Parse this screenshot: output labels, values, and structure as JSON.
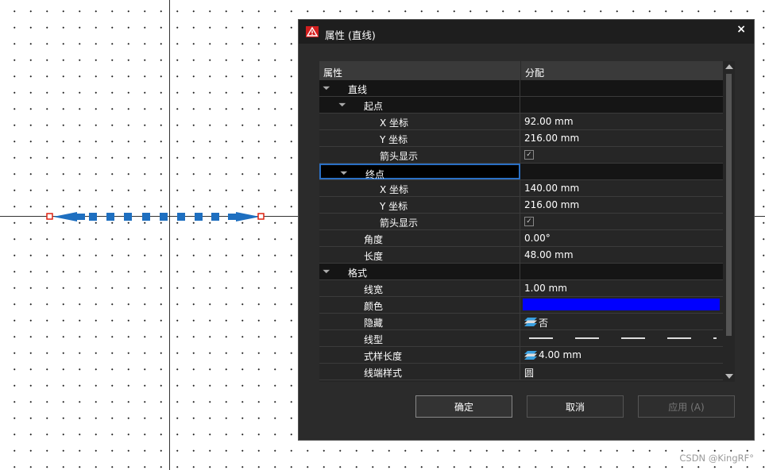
{
  "dialog": {
    "title": "属性 (直线)",
    "close_label": "×",
    "header": {
      "col_name": "属性",
      "col_value": "分配"
    },
    "rows": [
      {
        "label": "直线",
        "value": "",
        "level": 0,
        "kind": "group",
        "expandable": true
      },
      {
        "label": "起点",
        "value": "",
        "level": 1,
        "kind": "group",
        "expandable": true
      },
      {
        "label": "X 坐标",
        "value": "92.00 mm",
        "level": 2,
        "kind": "text"
      },
      {
        "label": "Y 坐标",
        "value": "216.00 mm",
        "level": 2,
        "kind": "text"
      },
      {
        "label": "箭头显示",
        "value": "",
        "level": 2,
        "kind": "checkbox",
        "checked": true
      },
      {
        "label": "终点",
        "value": "",
        "level": 1,
        "kind": "group",
        "expandable": true,
        "selected": true
      },
      {
        "label": "X 坐标",
        "value": "140.00 mm",
        "level": 2,
        "kind": "text"
      },
      {
        "label": "Y 坐标",
        "value": "216.00 mm",
        "level": 2,
        "kind": "text"
      },
      {
        "label": "箭头显示",
        "value": "",
        "level": 2,
        "kind": "checkbox",
        "checked": true
      },
      {
        "label": "角度",
        "value": "0.00°",
        "level": 1,
        "kind": "text"
      },
      {
        "label": "长度",
        "value": "48.00 mm",
        "level": 1,
        "kind": "text"
      },
      {
        "label": "格式",
        "value": "",
        "level": 0,
        "kind": "group",
        "expandable": true
      },
      {
        "label": "线宽",
        "value": "1.00 mm",
        "level": 1,
        "kind": "text"
      },
      {
        "label": "颜色",
        "value": "",
        "level": 1,
        "kind": "color",
        "color": "#0000ff"
      },
      {
        "label": "隐藏",
        "value": "否",
        "level": 1,
        "kind": "layer-text"
      },
      {
        "label": "线型",
        "value": "",
        "level": 1,
        "kind": "dash"
      },
      {
        "label": "式样长度",
        "value": "4.00 mm",
        "level": 1,
        "kind": "layer-text"
      },
      {
        "label": "线端样式",
        "value": "圆",
        "level": 1,
        "kind": "text"
      }
    ],
    "buttons": {
      "ok": "确定",
      "cancel": "取消",
      "apply": "应用 (A)"
    }
  },
  "watermark": "CSDN @KingRF°",
  "colors": {
    "line_blue": "#1e6fc0",
    "accent": "#2a6fc4",
    "swatch": "#0000ff"
  }
}
